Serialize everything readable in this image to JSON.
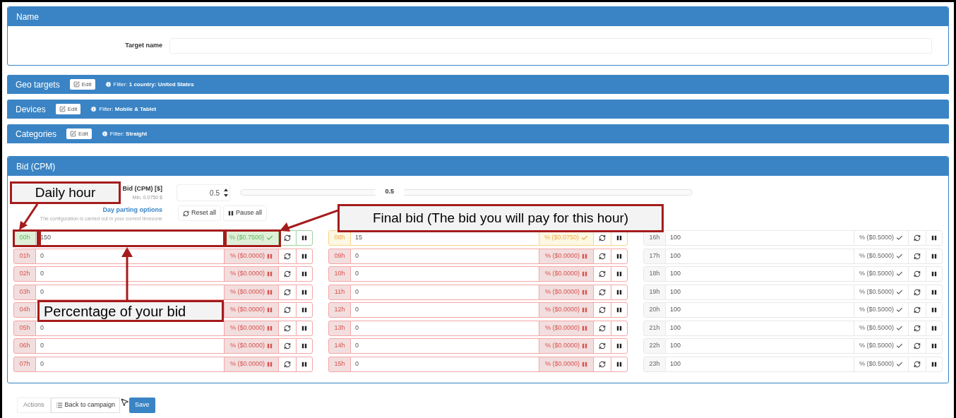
{
  "name_panel": {
    "title": "Name",
    "target_label": "Target name"
  },
  "filters": [
    {
      "title": "Geo targets",
      "edit": "Edit",
      "filter_label": "Filter:",
      "filter_value": "1 country: United States"
    },
    {
      "title": "Devices",
      "edit": "Edit",
      "filter_label": "Filter:",
      "filter_value": "Mobile & Tablet"
    },
    {
      "title": "Categories",
      "edit": "Edit",
      "filter_label": "Filter:",
      "filter_value": "Straight"
    }
  ],
  "bid_panel": {
    "title": "Bid (CPM)",
    "bid_label": "Bid (CPM) [$]",
    "min_label": "Min. 0.0750 $",
    "bid_value": "0.5",
    "slider": {
      "label": "0.5",
      "level": 0.33
    },
    "day_parting": "Day parting options",
    "timezone_note": "The configuration is carried out in your current timezone",
    "reset_all": "Reset all",
    "pause_all": "Pause all",
    "columns": [
      [
        {
          "hour": "00h",
          "value": "150",
          "final": "% ($0.7500)",
          "kind": "active"
        },
        {
          "hour": "01h",
          "value": "0",
          "final": "% ($0.0000)",
          "kind": "paused"
        },
        {
          "hour": "02h",
          "value": "0",
          "final": "% ($0.0000)",
          "kind": "paused"
        },
        {
          "hour": "03h",
          "value": "0",
          "final": "% ($0.0000)",
          "kind": "paused"
        },
        {
          "hour": "04h",
          "final": "% ($0.0000)",
          "kind": "paused"
        },
        {
          "hour": "05h",
          "value": "0",
          "final": "% ($0.0000)",
          "kind": "paused"
        },
        {
          "hour": "06h",
          "value": "0",
          "final": "% ($0.0000)",
          "kind": "paused"
        },
        {
          "hour": "07h",
          "value": "0",
          "final": "% ($0.0000)",
          "kind": "paused"
        }
      ],
      [
        {
          "hour": "08h",
          "value": "15",
          "final": "% ($0.0750)",
          "kind": "low"
        },
        {
          "hour": "09h",
          "value": "0",
          "final": "% ($0.0000)",
          "kind": "paused"
        },
        {
          "hour": "10h",
          "value": "0",
          "final": "% ($0.0000)",
          "kind": "paused"
        },
        {
          "hour": "11h",
          "value": "0",
          "final": "% ($0.0000)",
          "kind": "paused"
        },
        {
          "hour": "12h",
          "value": "0",
          "final": "% ($0.0000)",
          "kind": "paused"
        },
        {
          "hour": "13h",
          "value": "0",
          "final": "% ($0.0000)",
          "kind": "paused"
        },
        {
          "hour": "14h",
          "value": "0",
          "final": "% ($0.0000)",
          "kind": "paused"
        },
        {
          "hour": "15h",
          "value": "0",
          "final": "% ($0.0000)",
          "kind": "paused"
        }
      ],
      [
        {
          "hour": "16h",
          "value": "100",
          "final": "% ($0.5000)",
          "kind": "normal"
        },
        {
          "hour": "17h",
          "value": "100",
          "final": "% ($0.5000)",
          "kind": "normal"
        },
        {
          "hour": "18h",
          "value": "100",
          "final": "% ($0.5000)",
          "kind": "normal"
        },
        {
          "hour": "19h",
          "value": "100",
          "final": "% ($0.5000)",
          "kind": "normal"
        },
        {
          "hour": "20h",
          "value": "100",
          "final": "% ($0.5000)",
          "kind": "normal"
        },
        {
          "hour": "21h",
          "value": "100",
          "final": "% ($0.5000)",
          "kind": "normal"
        },
        {
          "hour": "22h",
          "value": "100",
          "final": "% ($0.5000)",
          "kind": "normal"
        },
        {
          "hour": "23h",
          "value": "100",
          "final": "% ($0.5000)",
          "kind": "normal"
        }
      ]
    ]
  },
  "actions": {
    "label": "Actions",
    "back": "Back to campaign",
    "save": "Save"
  },
  "annotations": [
    "Daily hour",
    "Percentage of your bid",
    "Final bid (The bid you will pay for this hour)"
  ]
}
